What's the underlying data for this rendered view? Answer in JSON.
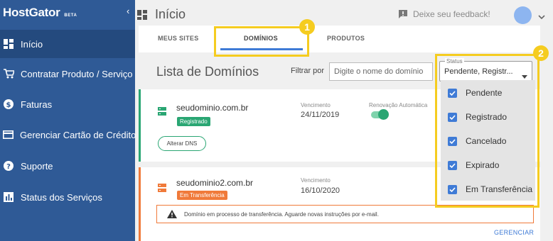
{
  "brand": {
    "name": "HostGator",
    "beta": "BETA"
  },
  "sidebar": {
    "items": [
      {
        "label": "Início",
        "icon": "dashboard-icon"
      },
      {
        "label": "Contratar Produto / Serviço",
        "icon": "cart-icon"
      },
      {
        "label": "Faturas",
        "icon": "dollar-icon"
      },
      {
        "label": "Gerenciar Cartão de Crédito",
        "icon": "credit-card-icon"
      },
      {
        "label": "Suporte",
        "icon": "help-icon"
      },
      {
        "label": "Status dos Serviços",
        "icon": "bar-chart-icon"
      }
    ]
  },
  "header": {
    "title": "Início",
    "feedback": "Deixe seu feedback!"
  },
  "tabs": [
    {
      "label": "MEUS SITES"
    },
    {
      "label": "DOMÍNIOS",
      "active": true
    },
    {
      "label": "PRODUTOS"
    }
  ],
  "list": {
    "title": "Lista de Domínios",
    "filter_label": "Filtrar por",
    "filter_placeholder": "Digite o nome do domínio"
  },
  "status_filter": {
    "legend": "Status",
    "value": "Pendente, Registr...",
    "options": [
      {
        "label": "Pendente",
        "checked": true
      },
      {
        "label": "Registrado",
        "checked": true
      },
      {
        "label": "Cancelado",
        "checked": true
      },
      {
        "label": "Expirado",
        "checked": true
      },
      {
        "label": "Em Transferência",
        "checked": true
      }
    ]
  },
  "domains": [
    {
      "name": "seudominio.com.br",
      "badge": "Registrado",
      "vencimento_label": "Vencimento",
      "vencimento": "24/11/2019",
      "renovacao_label": "Renovação Automática",
      "auto_renew": true,
      "action": "Alterar DNS"
    },
    {
      "name": "seudominio2.com.br",
      "badge": "Em Transferência",
      "vencimento_label": "Vencimento",
      "vencimento": "16/10/2020",
      "alert": "Domínio em processo de transferência. Aguarde novas instruções por e-mail.",
      "action": "GERENCIAR"
    }
  ],
  "annotations": [
    "1",
    "2"
  ],
  "colors": {
    "sidebar": "#2f5a96",
    "accent": "#3f7bd6",
    "registered": "#2aa673",
    "transfer": "#f07a3a",
    "highlight": "#f5cc20"
  }
}
